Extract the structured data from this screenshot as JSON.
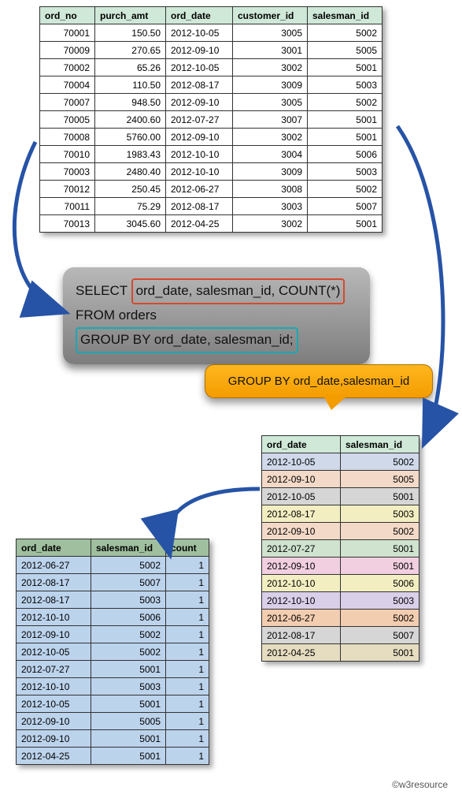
{
  "orders_table": {
    "headers": [
      "ord_no",
      "purch_amt",
      "ord_date",
      "customer_id",
      "salesman_id"
    ],
    "rows": [
      [
        "70001",
        "150.50",
        "2012-10-05",
        "3005",
        "5002"
      ],
      [
        "70009",
        "270.65",
        "2012-09-10",
        "3001",
        "5005"
      ],
      [
        "70002",
        "65.26",
        "2012-10-05",
        "3002",
        "5001"
      ],
      [
        "70004",
        "110.50",
        "2012-08-17",
        "3009",
        "5003"
      ],
      [
        "70007",
        "948.50",
        "2012-09-10",
        "3005",
        "5002"
      ],
      [
        "70005",
        "2400.60",
        "2012-07-27",
        "3007",
        "5001"
      ],
      [
        "70008",
        "5760.00",
        "2012-09-10",
        "3002",
        "5001"
      ],
      [
        "70010",
        "1983.43",
        "2012-10-10",
        "3004",
        "5006"
      ],
      [
        "70003",
        "2480.40",
        "2012-10-10",
        "3009",
        "5003"
      ],
      [
        "70012",
        "250.45",
        "2012-06-27",
        "3008",
        "5002"
      ],
      [
        "70011",
        "75.29",
        "2012-08-17",
        "3003",
        "5007"
      ],
      [
        "70013",
        "3045.60",
        "2012-04-25",
        "3002",
        "5001"
      ]
    ]
  },
  "sql": {
    "select_kw": "SELECT",
    "select_cols": "ord_date, salesman_id, COUNT(*)",
    "from_line": "FROM orders",
    "groupby_line": "GROUP BY ord_date, salesman_id;"
  },
  "callout": {
    "text": "GROUP BY ord_date,salesman_id"
  },
  "grouped_table": {
    "headers": [
      "ord_date",
      "salesman_id"
    ],
    "rows": [
      {
        "ord_date": "2012-10-05",
        "salesman_id": "5002",
        "color": "c-blue"
      },
      {
        "ord_date": "2012-09-10",
        "salesman_id": "5005",
        "color": "c-peach"
      },
      {
        "ord_date": "2012-10-05",
        "salesman_id": "5001",
        "color": "c-grey"
      },
      {
        "ord_date": "2012-08-17",
        "salesman_id": "5003",
        "color": "c-yellow"
      },
      {
        "ord_date": "2012-09-10",
        "salesman_id": "5002",
        "color": "c-peach"
      },
      {
        "ord_date": "2012-07-27",
        "salesman_id": "5001",
        "color": "c-green"
      },
      {
        "ord_date": "2012-09-10",
        "salesman_id": "5001",
        "color": "c-pink"
      },
      {
        "ord_date": "2012-10-10",
        "salesman_id": "5006",
        "color": "c-yellow"
      },
      {
        "ord_date": "2012-10-10",
        "salesman_id": "5003",
        "color": "c-violet"
      },
      {
        "ord_date": "2012-06-27",
        "salesman_id": "5002",
        "color": "c-orange"
      },
      {
        "ord_date": "2012-08-17",
        "salesman_id": "5007",
        "color": "c-grey"
      },
      {
        "ord_date": "2012-04-25",
        "salesman_id": "5001",
        "color": "c-sand"
      }
    ]
  },
  "result_table": {
    "headers": [
      "ord_date",
      "salesman_id",
      "count"
    ],
    "rows": [
      [
        "2012-06-27",
        "5002",
        "1"
      ],
      [
        "2012-08-17",
        "5007",
        "1"
      ],
      [
        "2012-08-17",
        "5003",
        "1"
      ],
      [
        "2012-10-10",
        "5006",
        "1"
      ],
      [
        "2012-09-10",
        "5002",
        "1"
      ],
      [
        "2012-10-05",
        "5002",
        "1"
      ],
      [
        "2012-07-27",
        "5001",
        "1"
      ],
      [
        "2012-10-10",
        "5003",
        "1"
      ],
      [
        "2012-10-05",
        "5001",
        "1"
      ],
      [
        "2012-09-10",
        "5005",
        "1"
      ],
      [
        "2012-09-10",
        "5001",
        "1"
      ],
      [
        "2012-04-25",
        "5001",
        "1"
      ]
    ]
  },
  "credit": "©w3resource"
}
